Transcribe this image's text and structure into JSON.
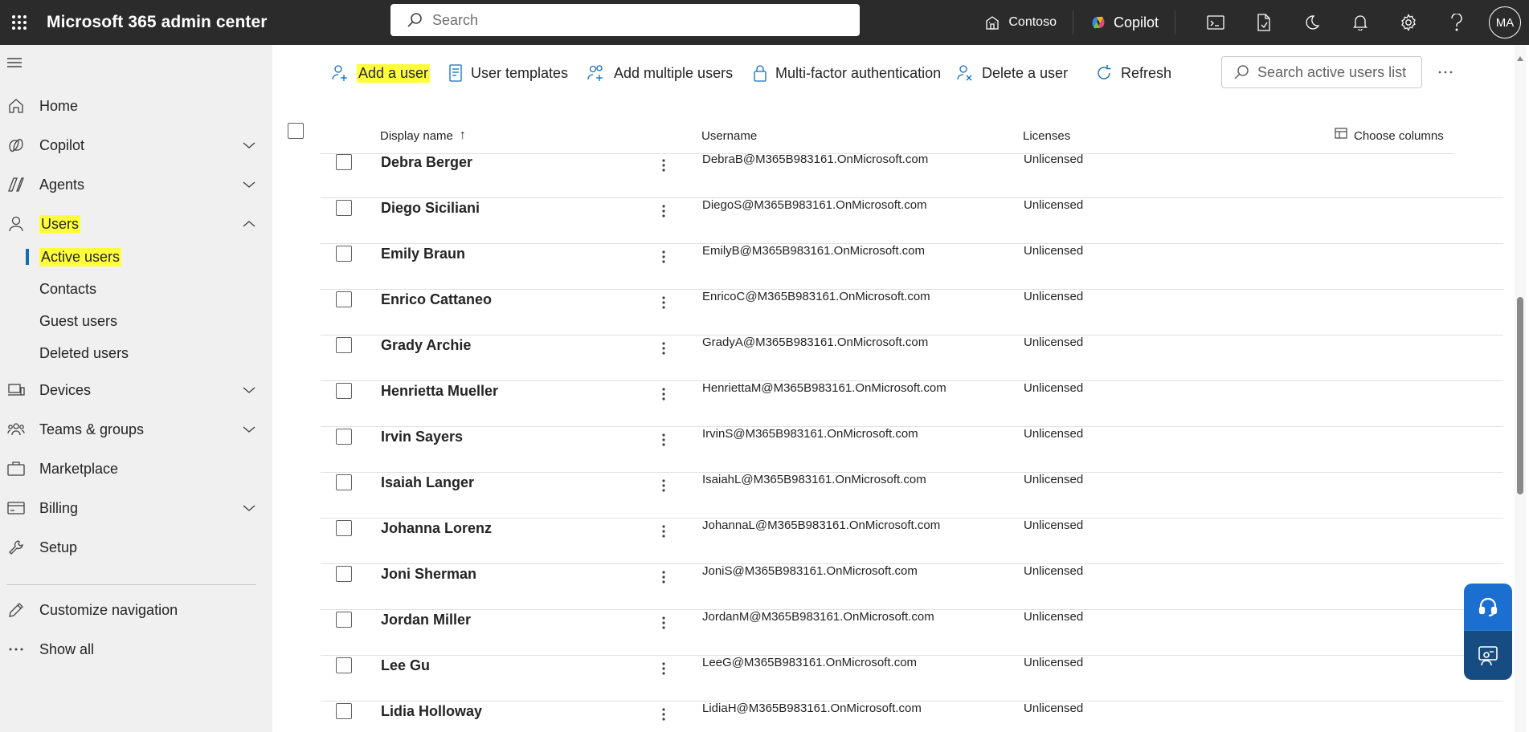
{
  "app": {
    "title": "Microsoft 365 admin center",
    "search_placeholder": "Search",
    "tenant": "Contoso",
    "copilot_label": "Copilot",
    "avatar_initials": "MA"
  },
  "sidebar": {
    "items": [
      {
        "label": "Home",
        "icon": "home-icon"
      },
      {
        "label": "Copilot",
        "icon": "copilot-icon"
      },
      {
        "label": "Agents",
        "icon": "agents-icon"
      },
      {
        "label": "Users",
        "icon": "person-icon"
      },
      {
        "label": "Devices",
        "icon": "devices-icon"
      },
      {
        "label": "Teams & groups",
        "icon": "people-team-icon"
      },
      {
        "label": "Marketplace",
        "icon": "briefcase-icon"
      },
      {
        "label": "Billing",
        "icon": "billing-icon"
      },
      {
        "label": "Setup",
        "icon": "wrench-icon"
      },
      {
        "label": "Customize navigation",
        "icon": "pencil-icon"
      },
      {
        "label": "Show all",
        "icon": "ellipsis-icon"
      }
    ],
    "users_sub": [
      "Active users",
      "Contacts",
      "Guest users",
      "Deleted users"
    ]
  },
  "toolbar": {
    "add_user": "Add a user",
    "user_templates": "User templates",
    "add_multiple": "Add multiple users",
    "mfa": "Multi-factor authentication",
    "delete_user": "Delete a user",
    "refresh": "Refresh",
    "search_placeholder": "Search active users list"
  },
  "table": {
    "headers": {
      "display_name": "Display name",
      "sort_indicator": "↑",
      "username": "Username",
      "licenses": "Licenses",
      "choose_columns": "Choose columns"
    },
    "rows": [
      {
        "name": "Debra Berger",
        "username": "DebraB@M365B983161.OnMicrosoft.com",
        "license": "Unlicensed"
      },
      {
        "name": "Diego Siciliani",
        "username": "DiegoS@M365B983161.OnMicrosoft.com",
        "license": "Unlicensed"
      },
      {
        "name": "Emily Braun",
        "username": "EmilyB@M365B983161.OnMicrosoft.com",
        "license": "Unlicensed"
      },
      {
        "name": "Enrico Cattaneo",
        "username": "EnricoC@M365B983161.OnMicrosoft.com",
        "license": "Unlicensed"
      },
      {
        "name": "Grady Archie",
        "username": "GradyA@M365B983161.OnMicrosoft.com",
        "license": "Unlicensed"
      },
      {
        "name": "Henrietta Mueller",
        "username": "HenriettaM@M365B983161.OnMicrosoft.com",
        "license": "Unlicensed"
      },
      {
        "name": "Irvin Sayers",
        "username": "IrvinS@M365B983161.OnMicrosoft.com",
        "license": "Unlicensed"
      },
      {
        "name": "Isaiah Langer",
        "username": "IsaiahL@M365B983161.OnMicrosoft.com",
        "license": "Unlicensed"
      },
      {
        "name": "Johanna Lorenz",
        "username": "JohannaL@M365B983161.OnMicrosoft.com",
        "license": "Unlicensed"
      },
      {
        "name": "Joni Sherman",
        "username": "JoniS@M365B983161.OnMicrosoft.com",
        "license": "Unlicensed"
      },
      {
        "name": "Jordan Miller",
        "username": "JordanM@M365B983161.OnMicrosoft.com",
        "license": "Unlicensed"
      },
      {
        "name": "Lee Gu",
        "username": "LeeG@M365B983161.OnMicrosoft.com",
        "license": "Unlicensed"
      },
      {
        "name": "Lidia Holloway",
        "username": "LidiaH@M365B983161.OnMicrosoft.com",
        "license": "Unlicensed"
      }
    ]
  },
  "colors": {
    "highlight": "#ffff3c",
    "topbar": "#2b2b2b",
    "accent": "#0f6cbd"
  }
}
